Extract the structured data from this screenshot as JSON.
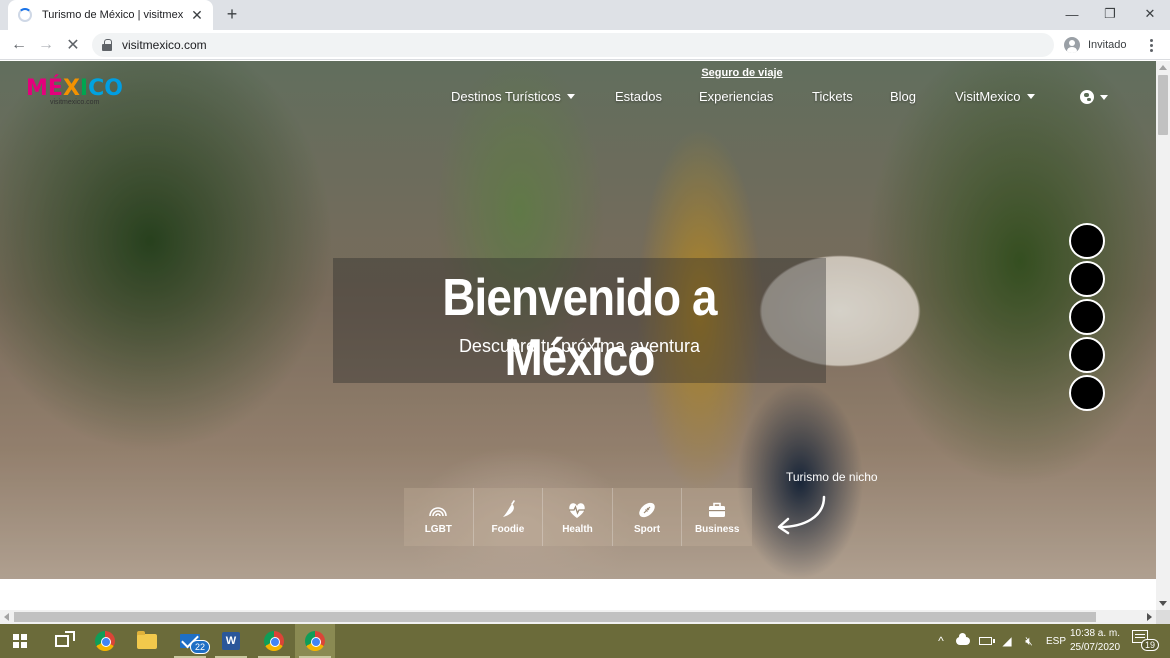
{
  "browser": {
    "tab_title": "Turismo de México | visitmexico.com",
    "url": "visitmexico.com",
    "profile_label": "Invitado"
  },
  "site": {
    "logo_text": "MÉXICO",
    "logo_subtext": "visitmexico.com",
    "top_link": "Seguro de viaje",
    "nav": [
      {
        "label": "Destinos Turísticos",
        "has_dropdown": true
      },
      {
        "label": "Estados",
        "has_dropdown": false
      },
      {
        "label": "Experiencias",
        "has_dropdown": false
      },
      {
        "label": "Tickets",
        "has_dropdown": false
      },
      {
        "label": "Blog",
        "has_dropdown": false
      },
      {
        "label": "VisitMexico",
        "has_dropdown": true
      }
    ],
    "hero_title": "Bienvenido a México",
    "hero_subtitle": "Descubre tu próxima aventura",
    "niche_label": "Turismo de nicho",
    "niche_items": [
      {
        "label": "LGBT",
        "icon": "rainbow-icon"
      },
      {
        "label": "Foodie",
        "icon": "pepper-icon"
      },
      {
        "label": "Health",
        "icon": "heartbeat-icon"
      },
      {
        "label": "Sport",
        "icon": "football-icon"
      },
      {
        "label": "Business",
        "icon": "briefcase-icon"
      }
    ]
  },
  "taskbar": {
    "mail_badge": "22",
    "language": "ESP",
    "time": "10:38 a. m.",
    "date": "25/07/2020",
    "notifications_badge": "19"
  },
  "colors": {
    "logo_letters": [
      "#e4007c",
      "#e4007c",
      "#f39200",
      "#00a650",
      "#00a3e0",
      "#009ee3"
    ],
    "taskbar": "#6b6b3a"
  }
}
